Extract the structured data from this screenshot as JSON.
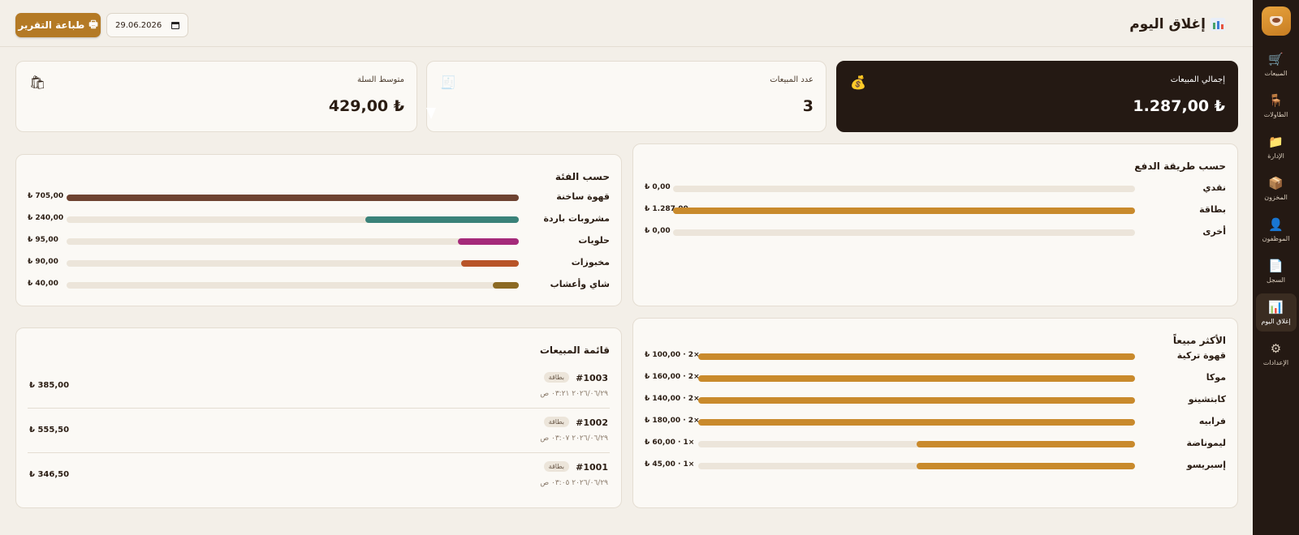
{
  "sidebar": {
    "items": [
      {
        "label": "المبيعات",
        "icon": "🛒"
      },
      {
        "label": "الطاولات",
        "icon": "🪑"
      },
      {
        "label": "الإدارة",
        "icon": "📁"
      },
      {
        "label": "المخزون",
        "icon": "📦"
      },
      {
        "label": "الموظفون",
        "icon": "👤"
      },
      {
        "label": "السجل",
        "icon": "📄"
      },
      {
        "label": "إغلاق اليوم",
        "icon": "📊"
      },
      {
        "label": "الإعدادات",
        "icon": "⚙"
      }
    ],
    "active_index": 6
  },
  "header": {
    "title": "إغلاق اليوم",
    "date_value": "29.06.2026",
    "print_label": "طباعة التقرير"
  },
  "stats": {
    "total_sales": {
      "label": "إجمالي المبيعات",
      "value": "₺ 1.287,00",
      "icon": "💰"
    },
    "sales_count": {
      "label": "عدد المبيعات",
      "value": "3",
      "icon": "🧾"
    },
    "avg_basket": {
      "label": "متوسط السلة",
      "value": "₺ 429,00",
      "icon": "🛍"
    }
  },
  "payment": {
    "title": "حسب طريقة الدفع",
    "rows": [
      {
        "label": "نقدي",
        "amount": "₺ 0,00",
        "fraction": 0,
        "color": "#c98a2c"
      },
      {
        "label": "بطاقة",
        "amount": "₺ 1.287,00",
        "fraction": 1,
        "color": "#c98a2c"
      },
      {
        "label": "أخرى",
        "amount": "₺ 0,00",
        "fraction": 0,
        "color": "#c98a2c"
      }
    ]
  },
  "category": {
    "title": "حسب الفئة",
    "rows": [
      {
        "label": "قهوة ساخنة",
        "amount": "₺ 705,00",
        "fraction": 1,
        "color": "#6e4331"
      },
      {
        "label": "مشروبات باردة",
        "amount": "₺ 240,00",
        "fraction": 0.34,
        "color": "#3a8279"
      },
      {
        "label": "حلويات",
        "amount": "₺ 95,00",
        "fraction": 0.135,
        "color": "#a52a7a"
      },
      {
        "label": "مخبوزات",
        "amount": "₺ 90,00",
        "fraction": 0.128,
        "color": "#b85428"
      },
      {
        "label": "شاي وأعشاب",
        "amount": "₺ 40,00",
        "fraction": 0.057,
        "color": "#8c6a24"
      }
    ]
  },
  "top": {
    "title": "الأكثر مبيعاً",
    "rows": [
      {
        "label": "قهوة تركية",
        "amount": "₺ 100,00 · 2×",
        "fraction": 1,
        "color": "#c98a2c"
      },
      {
        "label": "موكا",
        "amount": "₺ 160,00 · 2×",
        "fraction": 1,
        "color": "#c98a2c"
      },
      {
        "label": "كابتشينو",
        "amount": "₺ 140,00 · 2×",
        "fraction": 1,
        "color": "#c98a2c"
      },
      {
        "label": "فرابيه",
        "amount": "₺ 180,00 · 2×",
        "fraction": 1,
        "color": "#c98a2c"
      },
      {
        "label": "ليموناضة",
        "amount": "₺ 60,00 · 1×",
        "fraction": 0.5,
        "color": "#c98a2c"
      },
      {
        "label": "إسبريسو",
        "amount": "₺ 45,00 · 1×",
        "fraction": 0.5,
        "color": "#c98a2c"
      }
    ]
  },
  "sales_list": {
    "title": "قائمة المبيعات",
    "items": [
      {
        "id": "#1003",
        "badge": "بطاقة",
        "time": "٢٠٢٦/٠٦/٢٩ ٠٣:٢١ ص",
        "amount": "₺ 385,00"
      },
      {
        "id": "#1002",
        "badge": "بطاقة",
        "time": "٢٠٢٦/٠٦/٢٩ ٠٣:٠٧ ص",
        "amount": "₺ 555,50"
      },
      {
        "id": "#1001",
        "badge": "بطاقة",
        "time": "٢٠٢٦/٠٦/٢٩ ٠٣:٠٥ ص",
        "amount": "₺ 346,50"
      }
    ]
  }
}
